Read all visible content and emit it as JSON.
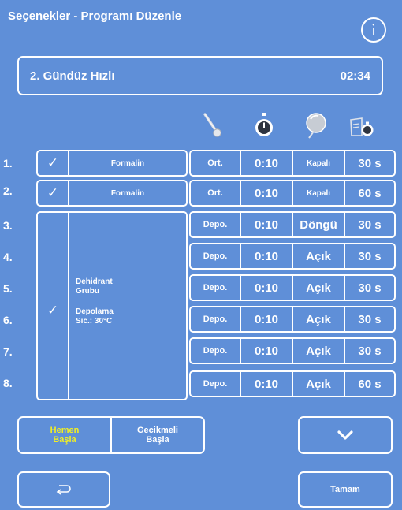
{
  "header": {
    "title": "Seçenekler - Programı Düzenle",
    "info_icon": "info-icon"
  },
  "program": {
    "name": "2. Gündüz Hızlı",
    "duration": "02:34"
  },
  "columns": {
    "icons": [
      "thermometer-icon",
      "stopwatch-icon",
      "vacuum-icon",
      "drip-timer-icon"
    ]
  },
  "rows": [
    {
      "num": "1.",
      "check": "✓",
      "reagent": "Formalin",
      "mode": "Ort.",
      "time": "0:10",
      "vacuum": "Kapalı",
      "drip": "30 s"
    },
    {
      "num": "2.",
      "check": "✓",
      "reagent": "Formalin",
      "mode": "Ort.",
      "time": "0:10",
      "vacuum": "Kapalı",
      "drip": "60 s"
    },
    {
      "num": "3.",
      "mode": "Depo.",
      "time": "0:10",
      "vacuum": "Döngü",
      "drip": "30 s"
    },
    {
      "num": "4.",
      "mode": "Depo.",
      "time": "0:10",
      "vacuum": "Açık",
      "drip": "30 s"
    },
    {
      "num": "5.",
      "mode": "Depo.",
      "time": "0:10",
      "vacuum": "Açık",
      "drip": "30 s"
    },
    {
      "num": "6.",
      "mode": "Depo.",
      "time": "0:10",
      "vacuum": "Açık",
      "drip": "30 s"
    },
    {
      "num": "7.",
      "mode": "Depo.",
      "time": "0:10",
      "vacuum": "Açık",
      "drip": "30 s"
    },
    {
      "num": "8.",
      "mode": "Depo.",
      "time": "0:10",
      "vacuum": "Açık",
      "drip": "60 s"
    }
  ],
  "group": {
    "check": "✓",
    "line1": "Dehidrant",
    "line2": "Grubu",
    "line3": "Depolama",
    "line4": "Sıc.: 30°C"
  },
  "footer": {
    "start_now_line1": "Hemen",
    "start_now_line2": "Başla",
    "start_delay_line1": "Gecikmeli",
    "start_delay_line2": "Başla",
    "down_icon": "chevron-down-icon",
    "back_icon": "return-icon",
    "ok_label": "Tamam"
  },
  "colors": {
    "background": "#5f8fd8",
    "accent": "#f3f022",
    "line": "#ffffff"
  }
}
